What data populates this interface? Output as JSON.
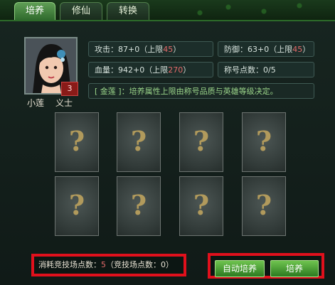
{
  "tabs": [
    {
      "label": "培养",
      "active": true
    },
    {
      "label": "修仙",
      "active": false
    },
    {
      "label": "转换",
      "active": false
    }
  ],
  "hero": {
    "name": "小莲",
    "class": "义士",
    "level_badge": "3"
  },
  "stats": {
    "attack_prefix": "攻击：87+0（上限",
    "attack_limit": "45",
    "defense_prefix": "防御：63+0（上限",
    "defense_limit": "45",
    "hp_prefix": "血量：942+0（上限",
    "hp_limit": "270",
    "title_points": "称号点数：0/5",
    "close_paren": "）"
  },
  "info_text": "[ 金莲 ]：培养属性上限由称号品质与英雄等级决定。",
  "slot_symbol": "?",
  "cost": {
    "prefix": "消耗竞技场点数：",
    "value": "5",
    "middle": "（竞技场点数：",
    "owned": "0",
    "suffix": "）"
  },
  "buttons": {
    "auto_train": "自动培养",
    "train": "培养"
  },
  "colors": {
    "accent_green": "#5f9e55",
    "highlight_red": "#e0101c",
    "limit_red": "#e46a6a",
    "info_green": "#9bd58a"
  }
}
